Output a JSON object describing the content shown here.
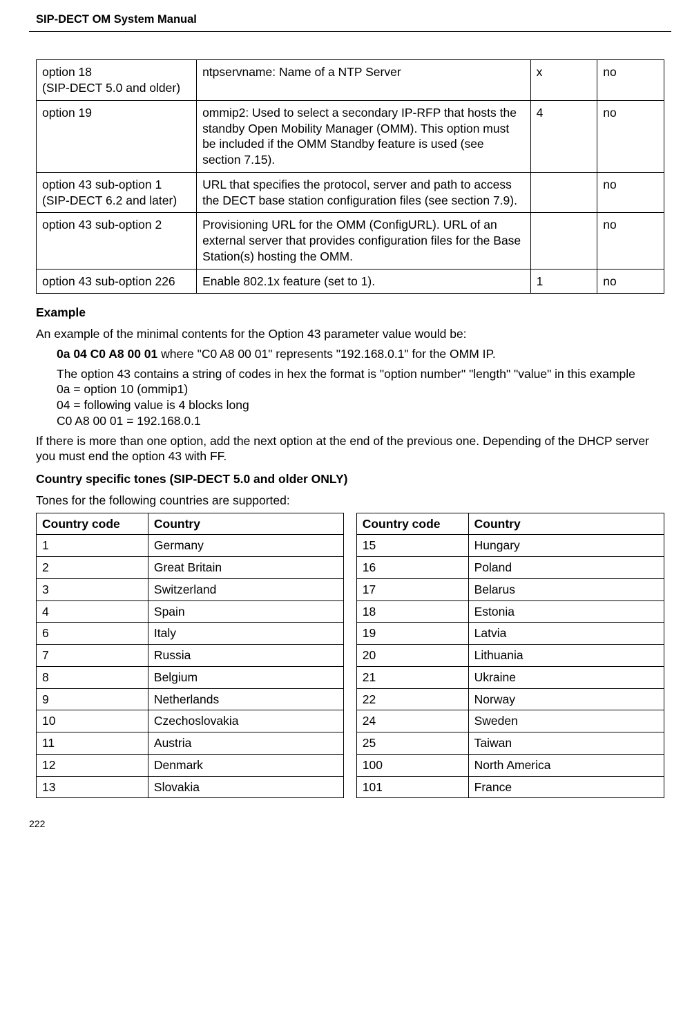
{
  "header": {
    "title": "SIP-DECT OM System Manual"
  },
  "options_table": {
    "rows": [
      {
        "opt": "option 18\n(SIP-DECT 5.0 and older)",
        "desc": "ntpservname: Name of a NTP Server",
        "c3": "x",
        "c4": "no"
      },
      {
        "opt": "option 19",
        "desc": "ommip2: Used to select a secondary IP-RFP that hosts the standby Open Mobility Manager (OMM). This option must be included if the OMM Standby feature is used (see section 7.15).",
        "c3": "4",
        "c4": "no"
      },
      {
        "opt": "option 43 sub-option 1\n(SIP-DECT 6.2 and later)",
        "desc": "URL that specifies the protocol, server and path to access the DECT base station configuration files (see section 7.9).",
        "c3": "",
        "c4": "no"
      },
      {
        "opt": "option 43 sub-option 2",
        "desc": "Provisioning URL for the OMM (ConfigURL). URL of an external server that provides configuration files for the Base Station(s) hosting the OMM.",
        "c3": "",
        "c4": "no"
      },
      {
        "opt": "option 43 sub-option 226",
        "desc": "Enable 802.1x feature (set to 1).",
        "c3": "1",
        "c4": "no"
      }
    ]
  },
  "example": {
    "heading": "Example",
    "intro": "An example of the minimal contents for the Option 43 parameter value would be:",
    "bold_code": "0a 04 C0 A8 00 01",
    "code_explain": " where \"C0 A8 00 01\" represents \"192.168.0.1\" for the OMM IP.",
    "para2": "The option 43 contains a string of codes in hex the format is \"option number\" \"length\" \"value\" in this example",
    "l1": "0a = option 10 (ommip1)",
    "l2": "04 = following value is 4 blocks long",
    "l3": "C0 A8 00 01 = 192.168.0.1",
    "after": "If there is more than one option, add the next option at the end of the previous one. Depending of the DHCP server you must end the option 43 with FF."
  },
  "countries": {
    "heading": "Country specific tones (SIP-DECT 5.0 and older ONLY)",
    "intro": "Tones for the following countries are supported:",
    "head": {
      "cc": "Country code",
      "cn": "Country"
    },
    "rows": [
      {
        "a_code": "1",
        "a_name": "Germany",
        "b_code": "15",
        "b_name": "Hungary"
      },
      {
        "a_code": "2",
        "a_name": "Great Britain",
        "b_code": "16",
        "b_name": "Poland"
      },
      {
        "a_code": "3",
        "a_name": "Switzerland",
        "b_code": "17",
        "b_name": "Belarus"
      },
      {
        "a_code": "4",
        "a_name": "Spain",
        "b_code": "18",
        "b_name": "Estonia"
      },
      {
        "a_code": "6",
        "a_name": "Italy",
        "b_code": "19",
        "b_name": "Latvia"
      },
      {
        "a_code": "7",
        "a_name": "Russia",
        "b_code": "20",
        "b_name": "Lithuania"
      },
      {
        "a_code": "8",
        "a_name": "Belgium",
        "b_code": "21",
        "b_name": "Ukraine"
      },
      {
        "a_code": "9",
        "a_name": "Netherlands",
        "b_code": "22",
        "b_name": "Norway"
      },
      {
        "a_code": "10",
        "a_name": "Czechoslovakia",
        "b_code": "24",
        "b_name": "Sweden"
      },
      {
        "a_code": "11",
        "a_name": "Austria",
        "b_code": "25",
        "b_name": "Taiwan"
      },
      {
        "a_code": "12",
        "a_name": "Denmark",
        "b_code": "100",
        "b_name": "North America"
      },
      {
        "a_code": "13",
        "a_name": "Slovakia",
        "b_code": "101",
        "b_name": "France"
      }
    ]
  },
  "footer": {
    "page": "222"
  }
}
